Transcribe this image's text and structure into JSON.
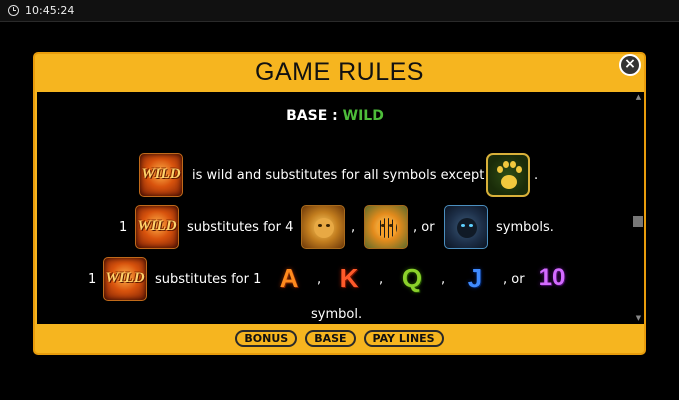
{
  "status_bar": {
    "time": "10:45:24"
  },
  "dialog": {
    "title": "GAME RULES",
    "close_label": "×",
    "section": {
      "prefix": "BASE :",
      "name": "WILD"
    },
    "rules": {
      "line1": {
        "text": "is wild and substitutes for all symbols except",
        "end": "."
      },
      "line2": {
        "count": "1",
        "text": "substitutes for 4",
        "sep1": ",",
        "sep2": ", or",
        "end": "symbols."
      },
      "line3": {
        "count": "1",
        "text": "substitutes for 1",
        "sep": ",",
        "sep_or": ", or",
        "end": "symbol."
      }
    },
    "symbols": {
      "wild_label": "WILD",
      "letters": [
        "A",
        "K",
        "Q",
        "J",
        "10"
      ]
    },
    "tabs": [
      {
        "label": "BONUS"
      },
      {
        "label": "BASE"
      },
      {
        "label": "PAY LINES"
      }
    ]
  },
  "colors": {
    "panel": "#f6b51f",
    "wild_heading": "#4dbd3a"
  }
}
